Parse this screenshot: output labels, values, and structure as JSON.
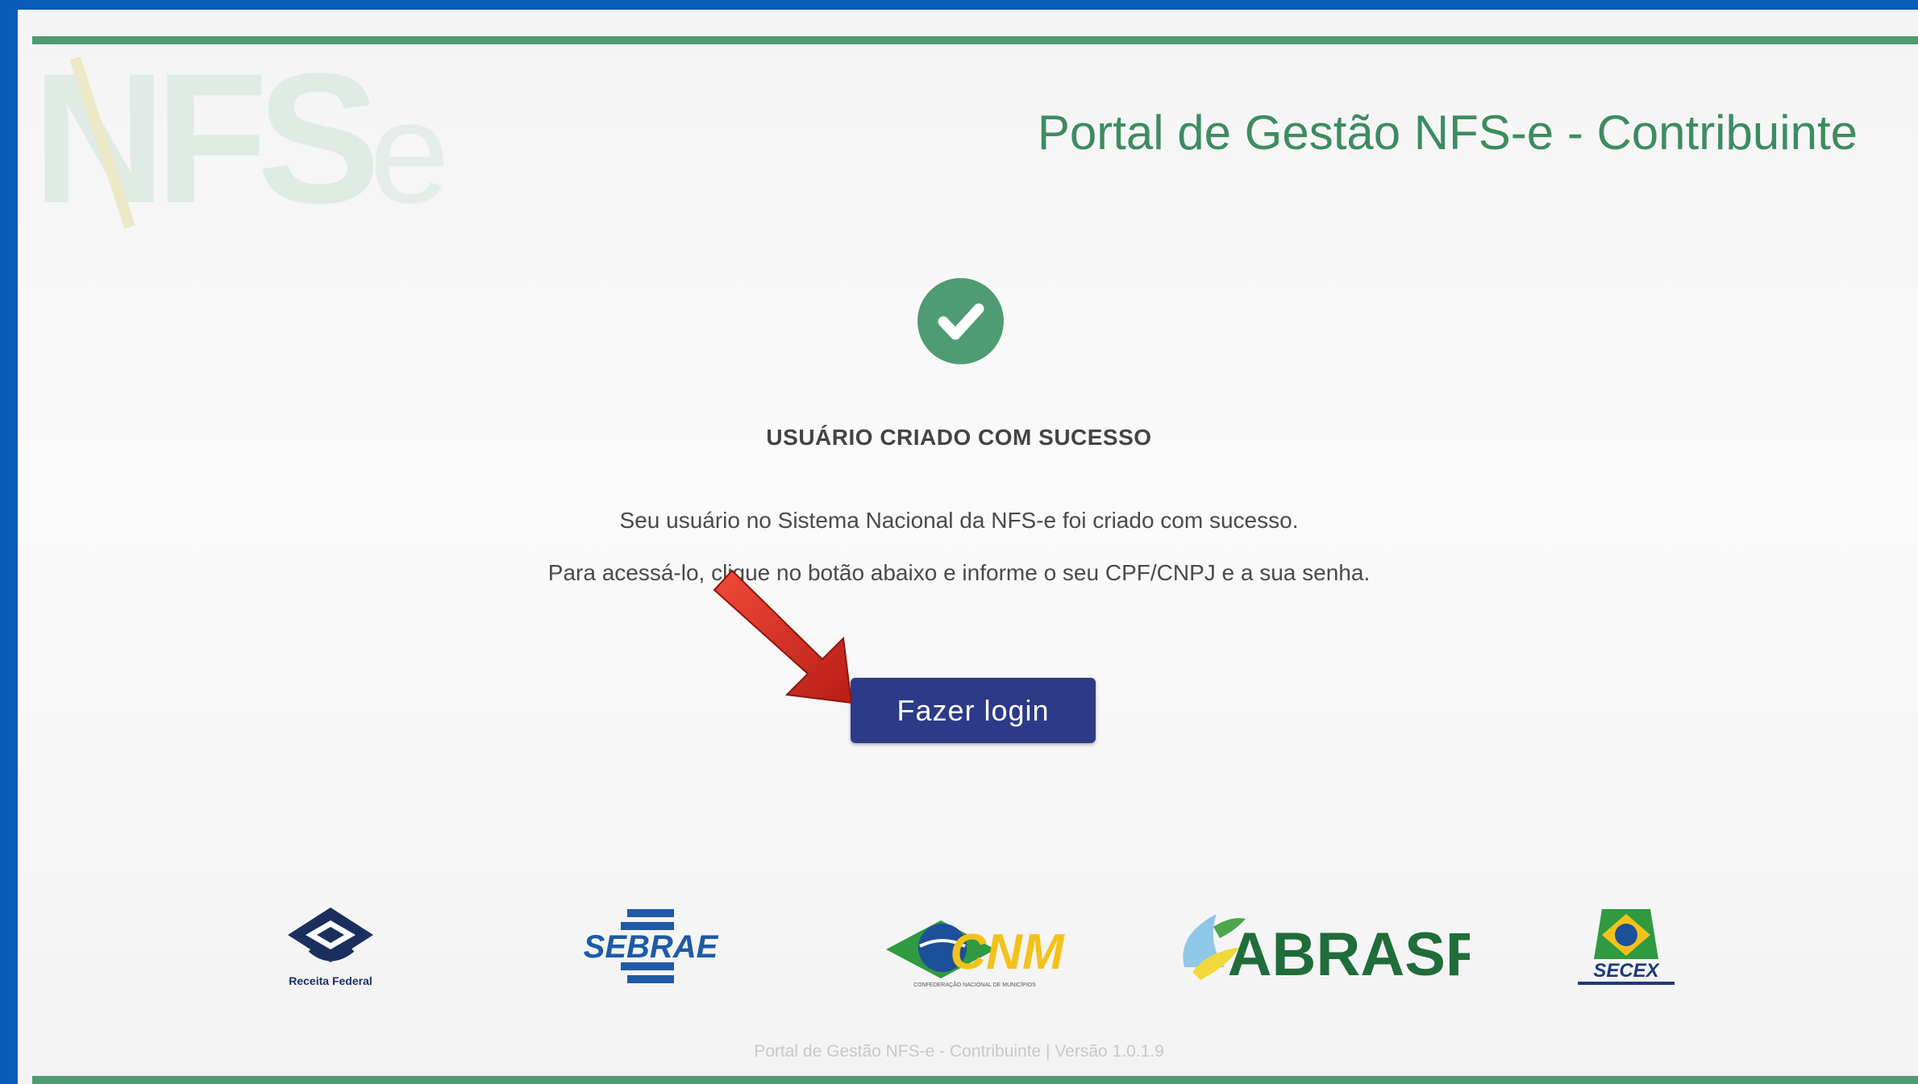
{
  "header": {
    "watermark": "NFS",
    "watermark_e": "e",
    "title": "Portal de Gestão NFS-e - Contribuinte"
  },
  "status": {
    "icon": "check-circle-icon",
    "title": "USUÁRIO CRIADO COM SUCESSO",
    "message_line1": "Seu usuário no Sistema Nacional da NFS-e foi criado com sucesso.",
    "message_line2": "Para acessá-lo, clique no botão abaixo e informe o seu CPF/CNPJ e a sua senha."
  },
  "actions": {
    "login_label": "Fazer login"
  },
  "logos": {
    "receita": "Receita Federal",
    "sebrae": "SEBRAE",
    "cnm": "CNM",
    "cnm_sub": "CONFEDERAÇÃO NACIONAL DE MUNICÍPIOS",
    "abrasf": "ABRASF",
    "secex": "SECEX"
  },
  "footer": {
    "text": "Portal de Gestão NFS-e - Contribuinte | Versão 1.0.1.9"
  },
  "colors": {
    "frame_blue": "#0a5cb8",
    "accent_green": "#4f9b73",
    "button_navy": "#2d3a87",
    "arrow_red": "#d42a20"
  }
}
